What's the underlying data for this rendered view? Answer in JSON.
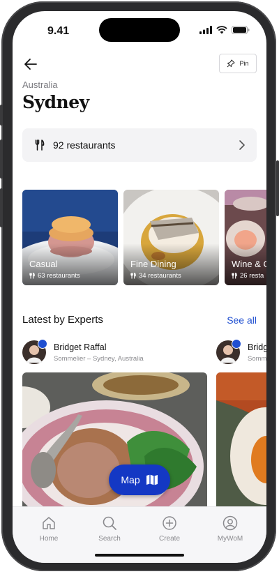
{
  "status": {
    "time": "9.41"
  },
  "header": {
    "pin_label": "Pin",
    "breadcrumb": "Australia",
    "title": "Sydney"
  },
  "restaurants_card": {
    "label": "92 restaurants"
  },
  "categories": [
    {
      "name": "Casual",
      "count": "63 restaurants"
    },
    {
      "name": "Fine Dining",
      "count": "34 restaurants"
    },
    {
      "name": "Wine & C",
      "count": "26 resta"
    }
  ],
  "experts_section": {
    "title": "Latest by Experts",
    "see_all": "See all",
    "experts": [
      {
        "name": "Bridget Raffal",
        "role": "Sommelier  – Sydney, Australia"
      },
      {
        "name": "Bridg",
        "role": "Somm"
      }
    ]
  },
  "map_button": {
    "label": "Map"
  },
  "tabbar": {
    "items": [
      {
        "label": "Home",
        "icon": "home-icon"
      },
      {
        "label": "Search",
        "icon": "search-icon"
      },
      {
        "label": "Create",
        "icon": "plus-circle-icon"
      },
      {
        "label": "MyWoM",
        "icon": "user-icon"
      }
    ]
  },
  "colors": {
    "accent": "#1f4fd1",
    "map_button": "#1438c4",
    "card_bg": "#f3f3f5"
  }
}
